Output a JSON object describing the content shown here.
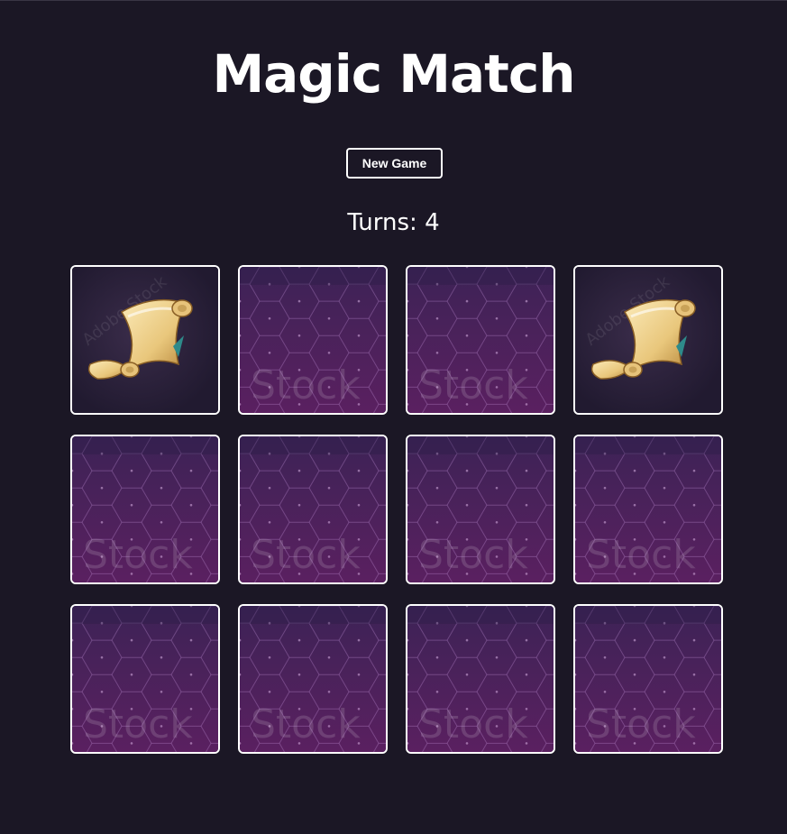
{
  "header": {
    "title": "Magic Match"
  },
  "controls": {
    "new_game_label": "New Game"
  },
  "status": {
    "turns_label": "Turns: 4"
  },
  "board": {
    "columns": 4,
    "rows": 3,
    "cards": [
      {
        "state": "revealed",
        "symbol": "scroll-icon"
      },
      {
        "state": "hidden"
      },
      {
        "state": "hidden"
      },
      {
        "state": "revealed",
        "symbol": "scroll-icon"
      },
      {
        "state": "hidden"
      },
      {
        "state": "hidden"
      },
      {
        "state": "hidden"
      },
      {
        "state": "hidden"
      },
      {
        "state": "hidden"
      },
      {
        "state": "hidden"
      },
      {
        "state": "hidden"
      },
      {
        "state": "hidden"
      }
    ],
    "card_back_watermark": "Stock",
    "card_front_watermark": "Adobe Stock"
  },
  "colors": {
    "background": "#1b1725",
    "card_back": "#4e2255",
    "card_front": "#241a33",
    "scroll": "#f0d79a",
    "border": "#ffffff"
  }
}
